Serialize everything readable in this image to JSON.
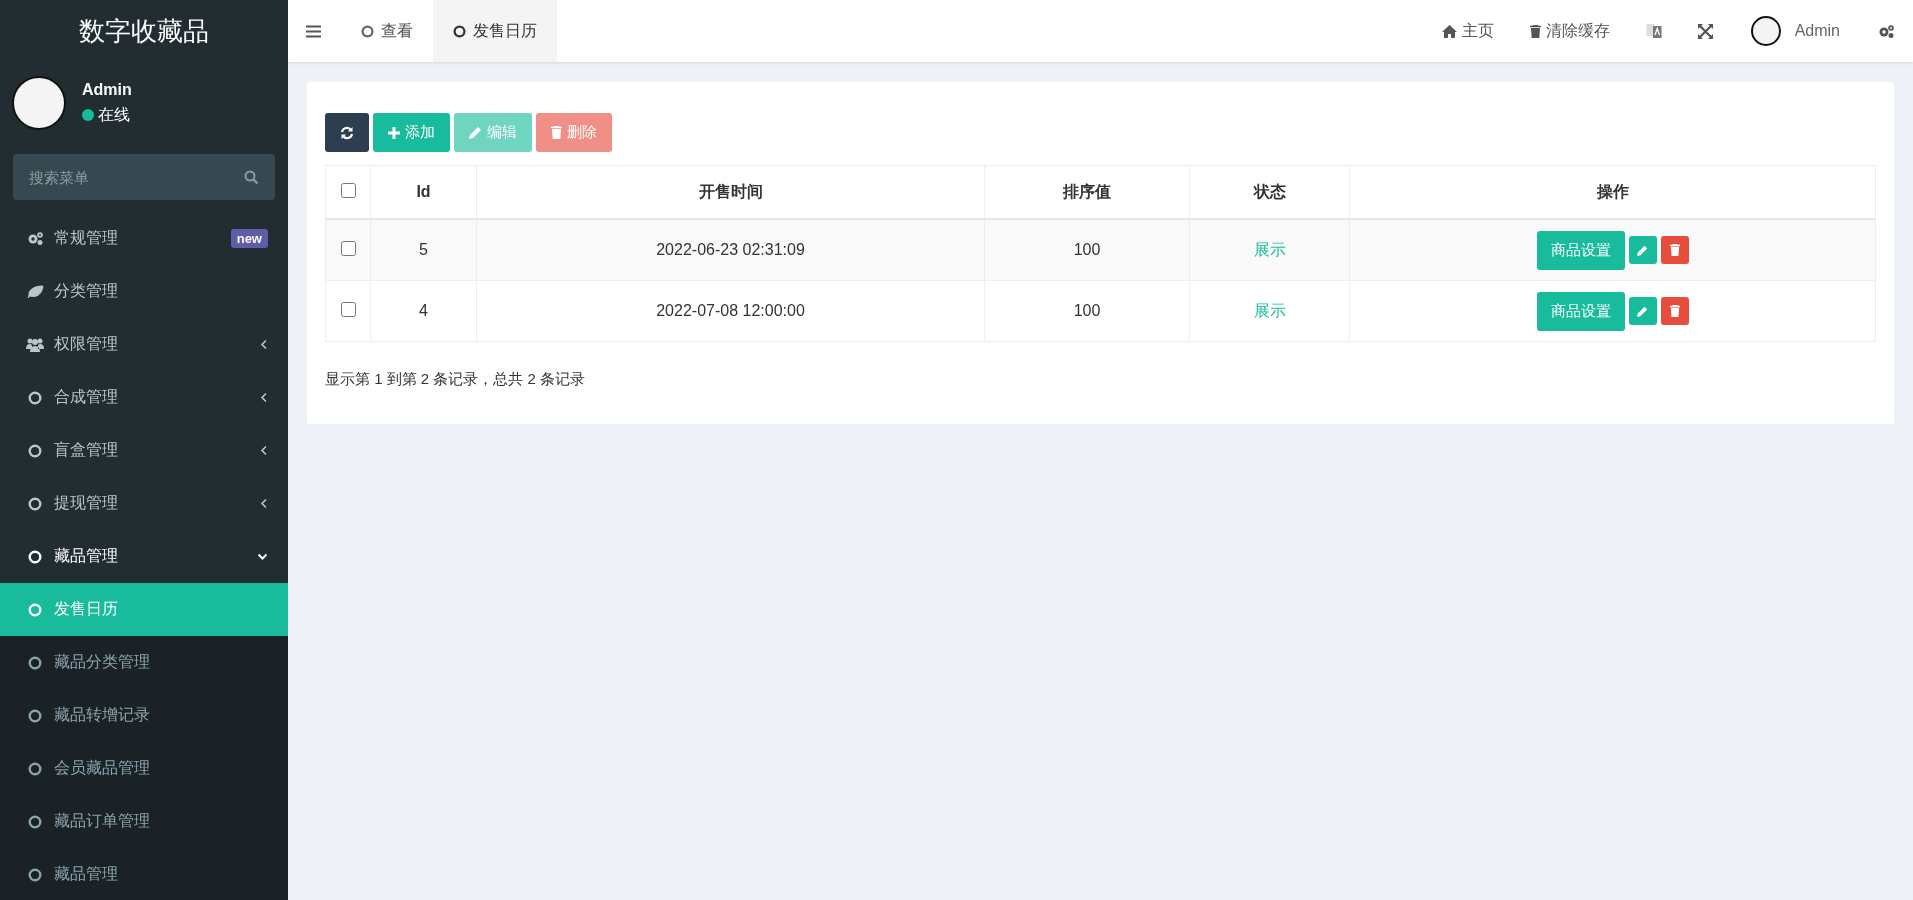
{
  "sidebar": {
    "title": "数字收藏品",
    "user": {
      "name": "Admin",
      "status": "在线"
    },
    "search": {
      "placeholder": "搜索菜单"
    },
    "menu": [
      {
        "label": "常规管理",
        "kind": "gears",
        "badge": "new",
        "selected": false
      },
      {
        "label": "分类管理",
        "kind": "leaf",
        "selected": false
      },
      {
        "label": "权限管理",
        "kind": "users",
        "expanded": false,
        "selected": false
      },
      {
        "label": "合成管理",
        "kind": "circle",
        "expanded": false,
        "selected": false
      },
      {
        "label": "盲盒管理",
        "kind": "circle",
        "expanded": false,
        "selected": false
      },
      {
        "label": "提现管理",
        "kind": "circle",
        "expanded": false,
        "selected": false
      },
      {
        "label": "藏品管理",
        "kind": "circle",
        "expanded": true,
        "selected": false,
        "children": [
          {
            "label": "发售日历",
            "selected": true
          },
          {
            "label": "藏品分类管理",
            "selected": false
          },
          {
            "label": "藏品转增记录",
            "selected": false
          },
          {
            "label": "会员藏品管理",
            "selected": false
          },
          {
            "label": "藏品订单管理",
            "selected": false
          },
          {
            "label": "藏品管理",
            "selected": false
          }
        ]
      }
    ]
  },
  "topbar": {
    "tabs": [
      {
        "label": "查看",
        "selected": false
      },
      {
        "label": "发售日历",
        "selected": true
      }
    ],
    "links": [
      {
        "label": "主页",
        "kind": "home"
      },
      {
        "label": "清除缓存",
        "kind": "trash"
      }
    ],
    "user": {
      "name": "Admin"
    }
  },
  "toolbar": {
    "buttons": [
      {
        "kind": "refresh",
        "disabled": false
      },
      {
        "kind": "add",
        "label": "添加",
        "disabled": false
      },
      {
        "kind": "edit",
        "label": "编辑",
        "disabled": true
      },
      {
        "kind": "delete",
        "label": "删除",
        "disabled": true
      }
    ]
  },
  "table": {
    "header_checked": false,
    "columns": [
      "Id",
      "开售时间",
      "排序值",
      "状态",
      "操作"
    ],
    "rows": [
      {
        "checked": false,
        "id": "5",
        "sale_time": "2022-06-23 02:31:09",
        "sort": "100",
        "status": "展示",
        "action": "商品设置"
      },
      {
        "checked": false,
        "id": "4",
        "sale_time": "2022-07-08 12:00:00",
        "sort": "100",
        "status": "展示",
        "action": "商品设置"
      }
    ]
  },
  "footer": "显示第 1 到第 2 条记录，总共 2 条记录"
}
